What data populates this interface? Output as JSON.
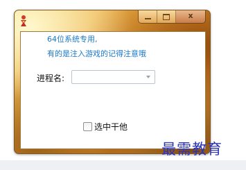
{
  "window": {
    "caption_buttons": {
      "minimize_icon": "minimize-icon",
      "maximize_icon": "maximize-icon",
      "close_glyph": "x"
    }
  },
  "notes": {
    "line1": "64位系统专用,",
    "line2": "有的是注入游戏的记得注意哦"
  },
  "form": {
    "process_label": "进程名:",
    "process_value": ""
  },
  "checkbox": {
    "label": "选中干他",
    "checked": false
  },
  "watermark": "最需教育",
  "colors": {
    "note_text": "#1a78c8",
    "watermark": "#2a33b8"
  }
}
